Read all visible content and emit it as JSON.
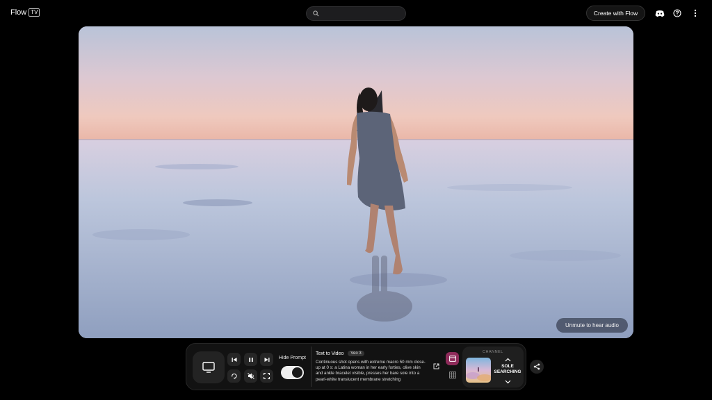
{
  "header": {
    "logo_text": "Flow",
    "logo_badge": "TV",
    "search_placeholder": "",
    "create_label": "Create with Flow",
    "icons": [
      "discord-icon",
      "help-icon",
      "more-vert-icon"
    ]
  },
  "video": {
    "unmute_label": "Unmute to hear audio"
  },
  "controls": {
    "hide_prompt_label": "Hide Prompt",
    "hide_prompt_on": true,
    "icons": [
      "tv-icon",
      "skip-previous-icon",
      "pause-icon",
      "skip-next-icon",
      "loop-icon",
      "mute-icon",
      "fullscreen-icon"
    ]
  },
  "prompt": {
    "mode": "Text to Video",
    "model": "Veo 3",
    "text": "Continuous shot opens with extreme macro 50 mm close-up at 0 s: a Latina woman in her early forties, olive skin and ankle bracelet visible, presses her bare sole into a pearl-white translucent membrane stretching"
  },
  "channel": {
    "label": "CHANNEL",
    "name": "SOLE SEARCHING"
  },
  "colors": {
    "accent": "#8e2b5a",
    "background": "#000000",
    "panel": "#121212"
  }
}
